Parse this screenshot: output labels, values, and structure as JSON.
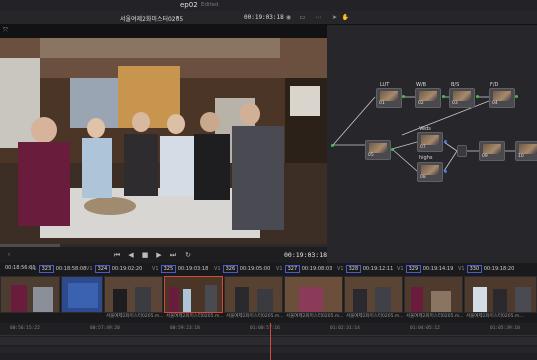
{
  "header": {
    "title": "ep02",
    "status": "Edited"
  },
  "viewer": {
    "clip_name": "서울여제2화미스터0205",
    "timecode_top": "00:19:03:18",
    "timecode_bottom": "00:19:03:18"
  },
  "nodes": {
    "labels": {
      "lut": "LUT",
      "wb": "W/B",
      "bs": "B/S",
      "fd": "F/D",
      "veds": "Veds",
      "highs": "highs"
    },
    "numbers": {
      "n01": "01",
      "n02": "02",
      "n03": "03",
      "n04": "04",
      "n05": "05",
      "n06": "06",
      "n07": "07",
      "n08": "08",
      "n09": "09",
      "n10": "10"
    }
  },
  "clips": [
    {
      "tc": "00:18:56:01",
      "num": "",
      "label": ""
    },
    {
      "tc": "00:18:58:08",
      "num": "323",
      "label": ""
    },
    {
      "tc": "00:19:02:20",
      "num": "324",
      "label": "서울여제2화미스터0205.m..."
    },
    {
      "tc": "00:19:03:18",
      "num": "325",
      "label": "서울여제2화미스터0205.m..."
    },
    {
      "tc": "00:19:05:00",
      "num": "326",
      "label": "서울여제2화미스터0205.m..."
    },
    {
      "tc": "00:19:08:03",
      "num": "327",
      "label": "서울여제2화미스터0205.m..."
    },
    {
      "tc": "00:19:12:11",
      "num": "328",
      "label": "서울여제2화미스터0205.m..."
    },
    {
      "tc": "00:19:14:19",
      "num": "329",
      "label": "서울여제2화미스터0205.m..."
    },
    {
      "tc": "00:19:18:20",
      "num": "330",
      "label": "서울여제2화미스터0205.m..."
    }
  ],
  "ruler": [
    "00:56:15:22",
    "00:57:49:20",
    "00:59:23:18",
    "01:00:57:16",
    "01:02:31:14",
    "01:04:05:12",
    "01:05:39:10"
  ],
  "colors": {
    "accent": "#d14a3a",
    "clipnum_border": "#4a5bd0",
    "node_green": "#3ec446",
    "node_blue": "#3a7fe0"
  }
}
